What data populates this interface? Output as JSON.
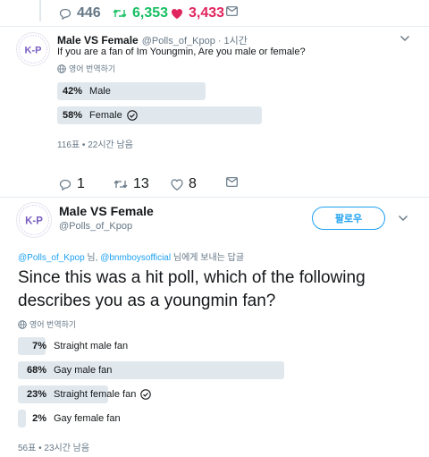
{
  "top_actions": {
    "reply_count": "446",
    "retweet_count": "6,353",
    "like_count": "3,433"
  },
  "tweet1": {
    "display_name": "Male VS Female",
    "handle": "@Polls_of_Kpop",
    "time": "· 1시간",
    "text": "If you are a fan of Im Youngmin, Are you male or female?",
    "translate": "영어 번역하기",
    "poll": [
      {
        "pct": "42%",
        "label": "Male",
        "value": 42,
        "voted": false
      },
      {
        "pct": "58%",
        "label": "Female",
        "value": 58,
        "voted": true
      }
    ],
    "poll_meta": "116표 • 22시간 남음",
    "reply_count": "1",
    "retweet_count": "13",
    "like_count": "8"
  },
  "tweet2": {
    "display_name": "Male VS Female",
    "handle": "@Polls_of_Kpop",
    "follow_label": "팔로우",
    "reply_prefix_1": "@Polls_of_Kpop",
    "reply_sep": " 님, ",
    "reply_prefix_2": "@bnmboysofficial",
    "reply_suffix": " 님에게 보내는 답글",
    "text": "Since this was a hit poll, which of the following describes you as a youngmin fan?",
    "translate": "영어 번역하기",
    "poll": [
      {
        "pct": "7%",
        "label": "Straight male fan",
        "value": 7,
        "voted": false
      },
      {
        "pct": "68%",
        "label": "Gay male fan",
        "value": 68,
        "voted": false
      },
      {
        "pct": "23%",
        "label": "Straight female fan",
        "value": 23,
        "voted": true
      },
      {
        "pct": "2%",
        "label": "Gay female fan",
        "value": 2,
        "voted": false
      }
    ],
    "poll_meta": "56표 • 23시간 남음"
  },
  "avatar_text": "K-P",
  "colors": {
    "accent": "#1da1f2",
    "retweet": "#17bf63",
    "like": "#e0245e",
    "muted": "#657786",
    "bar": "#e1e8ed"
  },
  "icons": {
    "reply": "reply-icon",
    "retweet": "retweet-icon",
    "like": "heart-icon",
    "dm": "envelope-icon",
    "globe": "globe-icon",
    "check": "check-circle-icon",
    "more": "chevron-down-icon"
  }
}
